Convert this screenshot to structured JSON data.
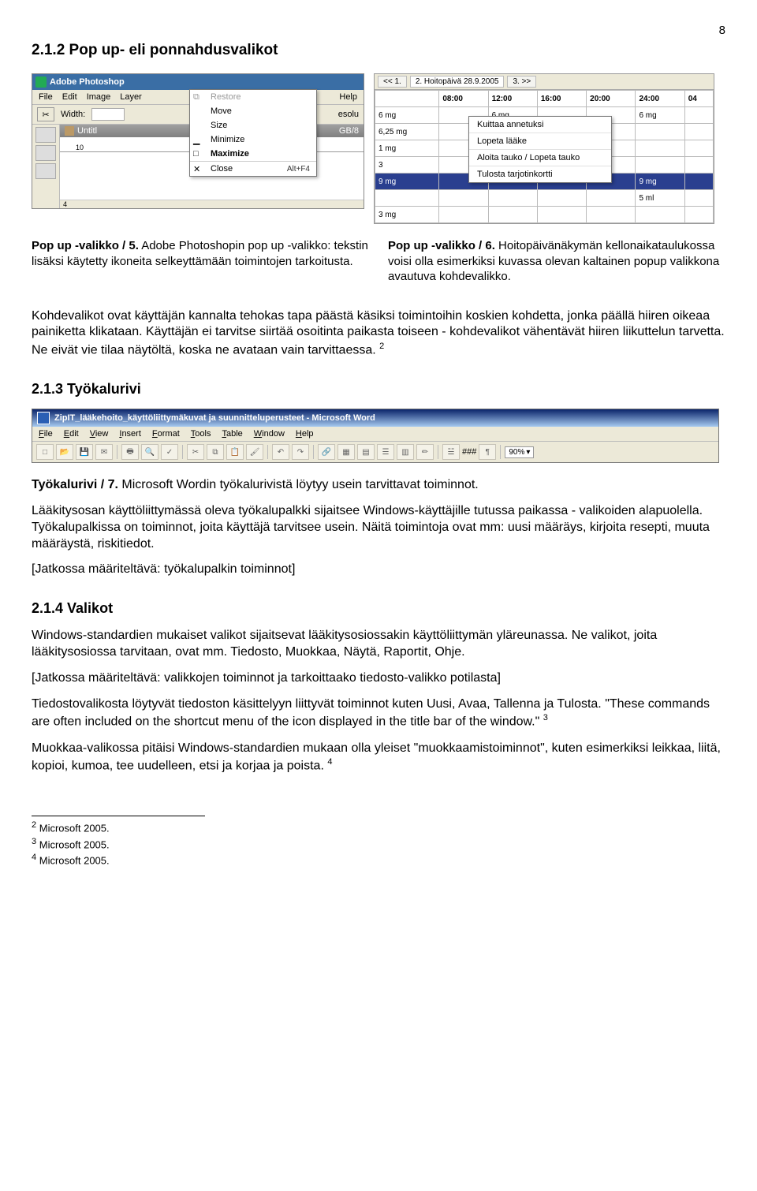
{
  "page_number": "8",
  "heading_1": "2.1.2  Pop up- eli ponnahdusvalikot",
  "photoshop": {
    "app_title": "Adobe Photoshop",
    "menu": [
      "File",
      "Edit",
      "Image",
      "Layer"
    ],
    "menu_right": "Help",
    "options_label": "Width:",
    "options_right": "esolu",
    "doc_title_left": "Untitl",
    "doc_title_right": "GB/8",
    "ruler_marks": [
      "10"
    ],
    "ruler_sidemark": "4",
    "popup": [
      {
        "label": "Restore",
        "disabled": true
      },
      {
        "label": "Move"
      },
      {
        "label": "Size"
      },
      {
        "label": "Minimize"
      },
      {
        "label": "Maximize",
        "bold": true
      },
      {
        "label": "Close",
        "shortcut": "Alt+F4",
        "sep": true
      }
    ]
  },
  "calendar": {
    "tabs_left": "<< 1.",
    "tabs_mid": "2. Hoitopäivä 28.9.2005",
    "tabs_right": "3. >>",
    "headers": [
      "08:00",
      "12:00",
      "16:00",
      "20:00",
      "24:00",
      "04"
    ],
    "rows": [
      {
        "label": "6 mg",
        "c1": "",
        "c2": "6 mg",
        "c3": "",
        "c4": "6 mg"
      },
      {
        "label": "6,25 mg"
      },
      {
        "label": "1 mg"
      },
      {
        "label": "3"
      },
      {
        "label": "9 mg",
        "hilite": true,
        "c4": "9 mg"
      },
      {
        "label": "",
        "c4": "5 ml"
      },
      {
        "label": "3 mg"
      }
    ],
    "popup": [
      "Kuittaa annetuksi",
      "Lopeta lääke",
      "Aloita tauko / Lopeta tauko",
      "Tulosta tarjotinkortti"
    ]
  },
  "caption_left_b": "Pop up -valikko / 5.",
  "caption_left_rest": " Adobe Photoshopin pop up -valikko: tekstin lisäksi käytetty ikoneita selkeyttämään toimintojen tarkoitusta.",
  "caption_right_b": "Pop up -valikko / 6.",
  "caption_right_rest": " Hoitopäivänäkymän kellonaikataulukossa voisi olla esimerkiksi kuvassa olevan kaltainen popup valikkona avautuva kohdevalikko.",
  "para_kohdevalikot": "Kohdevalikot ovat käyttäjän kannalta tehokas tapa päästä käsiksi toimintoihin koskien kohdetta, jonka päällä hiiren oikeaa painiketta klikataan. Käyttäjän ei tarvitse siirtää osoitinta paikasta toiseen - kohdevalikot vähentävät hiiren liikuttelun tarvetta. Ne eivät vie tilaa näytöltä, koska ne avataan vain tarvittaessa. ",
  "fn2_ref": "2",
  "heading_2": "2.1.3  Työkalurivi",
  "word": {
    "title": "ZipIT_lääkehoito_käyttöliittymäkuvat ja suunnitteluperusteet - Microsoft Word",
    "menu": [
      "File",
      "Edit",
      "View",
      "Insert",
      "Format",
      "Tools",
      "Table",
      "Window",
      "Help"
    ],
    "zoom": "90%"
  },
  "caption_tool_b": "Työkalurivi / 7.",
  "caption_tool_rest": " Microsoft Wordin työkalurivistä löytyy usein tarvittavat toiminnot.",
  "para_tool": "Lääkitysosan käyttöliittymässä oleva työkalupalkki sijaitsee Windows-käyttäjille tutussa paikassa - valikoiden alapuolella. Työkalupalkissa on toiminnot, joita käyttäjä tarvitsee usein. Näitä toimintoja ovat mm: uusi määräys, kirjoita resepti, muuta määräystä, riskitiedot.",
  "bracket_tool": "[Jatkossa määriteltävä: työkalupalkin toiminnot]",
  "heading_3": "2.1.4  Valikot",
  "para_valikot1": "Windows-standardien mukaiset valikot sijaitsevat lääkitysosiossakin käyttöliittymän yläreunassa. Ne valikot, joita lääkitysosiossa tarvitaan, ovat mm. Tiedosto, Muokkaa, Näytä, Raportit, Ohje.",
  "bracket_valikot": "[Jatkossa määriteltävä: valikkojen toiminnot ja tarkoittaako tiedosto-valikko potilasta]",
  "para_valikot2a": "Tiedostovalikosta löytyvät tiedoston käsittelyyn liittyvät toiminnot kuten Uusi, Avaa, Tallenna ja Tulosta. \"These commands are often included on the shortcut menu of the icon displayed in the title bar of the window.\" ",
  "fn3_ref": "3",
  "para_valikot3a": "Muokkaa-valikossa pitäisi Windows-standardien mukaan olla yleiset \"muokkaamistoiminnot\", kuten esimerkiksi leikkaa, liitä, kopioi, kumoa, tee uudelleen, etsi ja korjaa ja poista. ",
  "fn4_ref": "4",
  "footnotes": {
    "f2": "Microsoft 2005.",
    "f3": "Microsoft 2005.",
    "f4": "Microsoft 2005."
  }
}
